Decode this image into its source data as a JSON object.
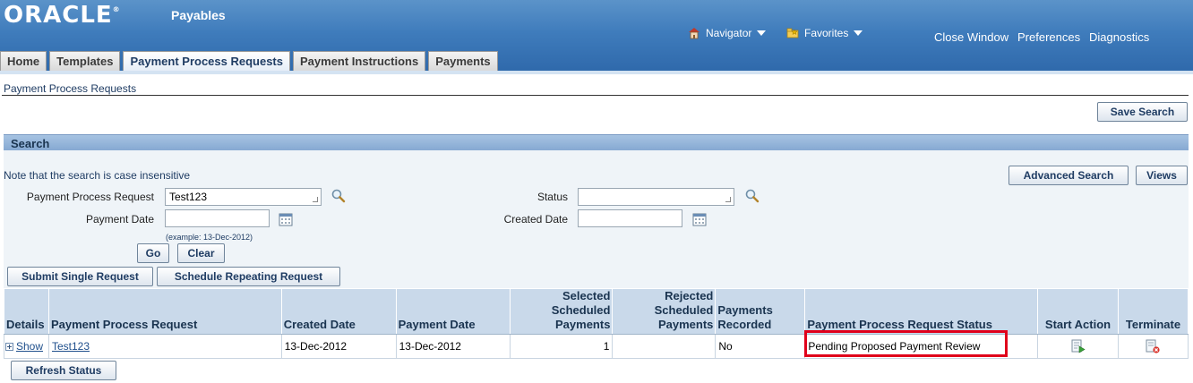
{
  "header": {
    "logo_text": "ORACLE",
    "logo_mark": "®",
    "app_name": "Payables",
    "navigator_label": "Navigator",
    "favorites_label": "Favorites",
    "links": [
      "Close Window",
      "Preferences",
      "Diagnostics"
    ]
  },
  "tabs": [
    {
      "label": "Home",
      "active": false
    },
    {
      "label": "Templates",
      "active": false
    },
    {
      "label": "Payment Process Requests",
      "active": true
    },
    {
      "label": "Payment Instructions",
      "active": false
    },
    {
      "label": "Payments",
      "active": false
    }
  ],
  "page": {
    "title": "Payment Process Requests",
    "save_search_label": "Save Search"
  },
  "search": {
    "section_title": "Search",
    "note": "Note that the search is case insensitive",
    "advanced_search_label": "Advanced Search",
    "views_label": "Views",
    "ppr_label": "Payment Process Request",
    "ppr_value": "Test123",
    "status_label": "Status",
    "status_value": "",
    "payment_date_label": "Payment Date",
    "payment_date_value": "",
    "created_date_label": "Created Date",
    "created_date_value": "",
    "date_example": "(example: 13-Dec-2012)",
    "go_label": "Go",
    "clear_label": "Clear"
  },
  "actions": {
    "submit_single_label": "Submit Single Request",
    "schedule_repeating_label": "Schedule Repeating Request",
    "refresh_status_label": "Refresh Status"
  },
  "table": {
    "headers": {
      "details": "Details",
      "ppr": "Payment Process Request",
      "created_date": "Created Date",
      "payment_date": "Payment Date",
      "selected_l1": "Selected",
      "selected_l2": "Scheduled",
      "selected_l3": "Payments",
      "rejected_l1": "Rejected",
      "rejected_l2": "Scheduled",
      "rejected_l3": "Payments",
      "recorded_l1": "Payments",
      "recorded_l2": "Recorded",
      "status": "Payment Process Request Status",
      "start_action": "Start Action",
      "terminate": "Terminate"
    },
    "rows": [
      {
        "show_label": "Show",
        "ppr": "Test123",
        "created_date": "13-Dec-2012",
        "payment_date": "13-Dec-2012",
        "selected": "1",
        "rejected": "",
        "recorded": "No",
        "status": "Pending Proposed Payment Review"
      }
    ]
  },
  "colors": {
    "header_blue": "#3f7cbc",
    "highlight_red": "#e0001b",
    "link_blue": "#1f4f8c"
  }
}
